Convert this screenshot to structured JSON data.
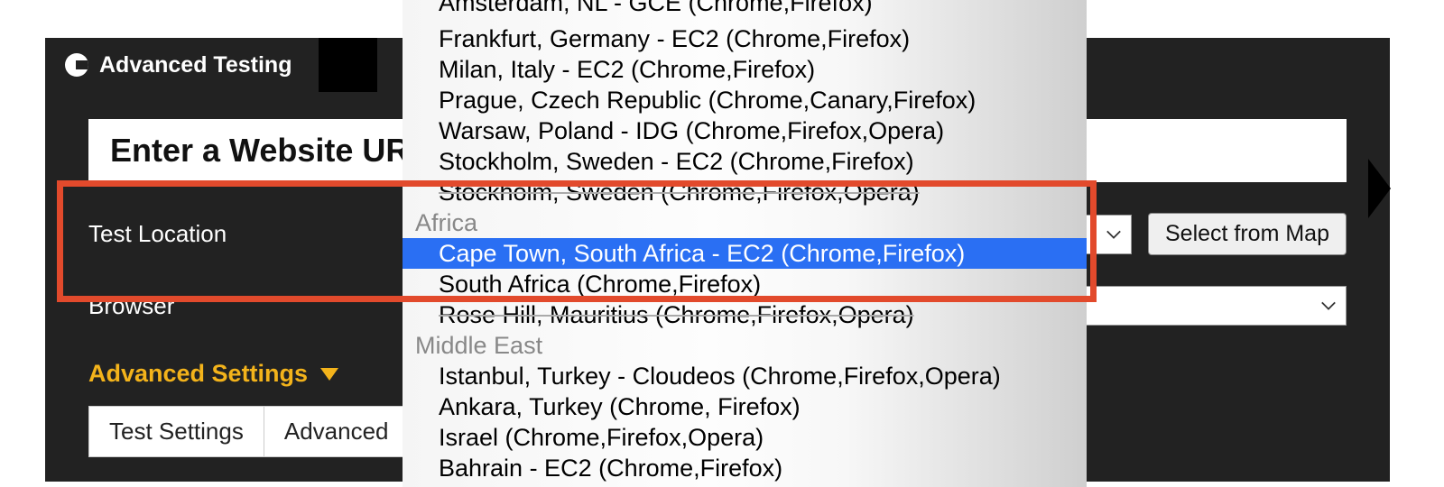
{
  "tab": {
    "label": "Advanced Testing"
  },
  "url_field": {
    "placeholder": "Enter a Website URL"
  },
  "fields": {
    "location_label": "Test Location",
    "browser_label": "Browser",
    "map_button": "Select from Map"
  },
  "advanced_link": "Advanced Settings",
  "sub_tabs": [
    "Test Settings",
    "Advanced"
  ],
  "dropdown": {
    "items": [
      {
        "type": "option-cut",
        "label": "Amsterdam, NL - GCE (Chrome,Firefox)"
      },
      {
        "type": "option",
        "label": "Frankfurt, Germany - EC2 (Chrome,Firefox)"
      },
      {
        "type": "option",
        "label": "Milan, Italy - EC2 (Chrome,Firefox)"
      },
      {
        "type": "option",
        "label": "Prague, Czech Republic (Chrome,Canary,Firefox)"
      },
      {
        "type": "option",
        "label": "Warsaw, Poland - IDG (Chrome,Firefox,Opera)"
      },
      {
        "type": "option",
        "label": "Stockholm, Sweden - EC2 (Chrome,Firefox)"
      },
      {
        "type": "option-strike",
        "label": "Stockholm, Sweden (Chrome,Firefox,Opera)"
      },
      {
        "type": "group",
        "label": "Africa"
      },
      {
        "type": "option-highlight",
        "label": "Cape Town, South Africa - EC2 (Chrome,Firefox)"
      },
      {
        "type": "option",
        "label": "South Africa (Chrome,Firefox)"
      },
      {
        "type": "option-strike",
        "label": "Rose Hill, Mauritius (Chrome,Firefox,Opera)"
      },
      {
        "type": "group",
        "label": "Middle East"
      },
      {
        "type": "option",
        "label": "Istanbul, Turkey - Cloudeos (Chrome,Firefox,Opera)"
      },
      {
        "type": "option",
        "label": "Ankara, Turkey (Chrome, Firefox)"
      },
      {
        "type": "option",
        "label": "Israel (Chrome,Firefox,Opera)"
      },
      {
        "type": "option",
        "label": "Bahrain - EC2 (Chrome,Firefox)"
      }
    ]
  }
}
